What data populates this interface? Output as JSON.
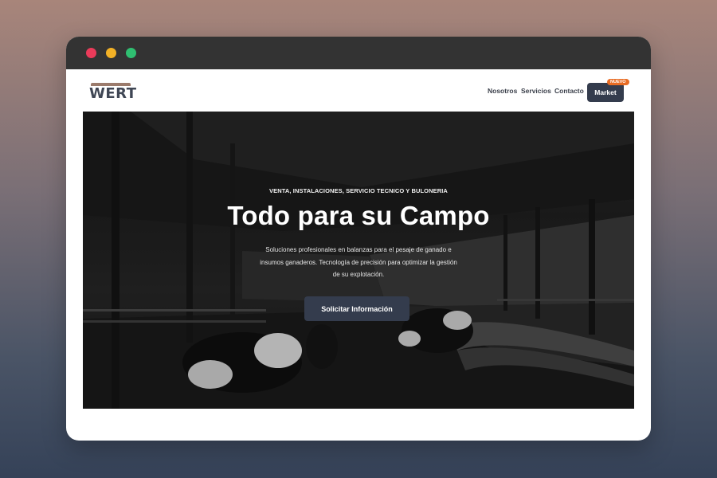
{
  "nav": {
    "logo_text": "WERT",
    "links": [
      "Nosotros",
      "Servicios",
      "Contacto"
    ],
    "market_label": "Market",
    "market_badge": "NUEVO"
  },
  "hero": {
    "kicker": "VENTA, INSTALACIONES, SERVICIO TECNICO Y BULONERIA",
    "title": "Todo para su Campo",
    "description": "Soluciones profesionales en balanzas para el pesaje de ganado e insumos ganaderos. Tecnología de precisión para optimizar la gestión de su explotación.",
    "cta_label": "Solicitar Información"
  },
  "colors": {
    "brand_dark": "#343c4d",
    "badge_orange": "#e86c24",
    "logo_bar": "#9b7b6c"
  },
  "icons": {
    "window_controls": [
      "close-dot",
      "minimize-dot",
      "maximize-dot"
    ]
  }
}
